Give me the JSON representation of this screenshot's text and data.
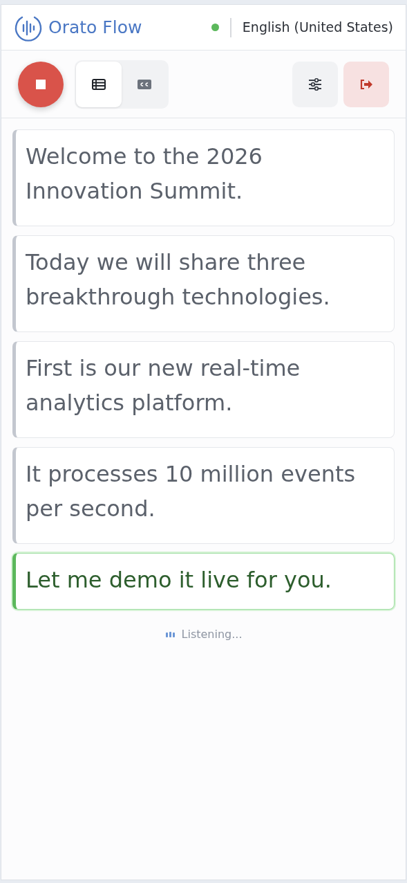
{
  "app": {
    "title": "Orato Flow",
    "connected": true,
    "language": "English (United States)"
  },
  "toolbar": {
    "recording": true,
    "view_tabs": [
      {
        "kind": "list",
        "selected": true
      },
      {
        "kind": "captions",
        "selected": false
      }
    ]
  },
  "transcript": [
    {
      "text": "Welcome to the 2026 Innovation Summit.",
      "active": false
    },
    {
      "text": "Today we will share three breakthrough technologies.",
      "active": false
    },
    {
      "text": "First is our new real-time analytics platform.",
      "active": false
    },
    {
      "text": "It processes 10 million events per second.",
      "active": false
    },
    {
      "text": "Let me demo it live for you.",
      "active": true
    }
  ],
  "status": {
    "text": "Listening..."
  }
}
